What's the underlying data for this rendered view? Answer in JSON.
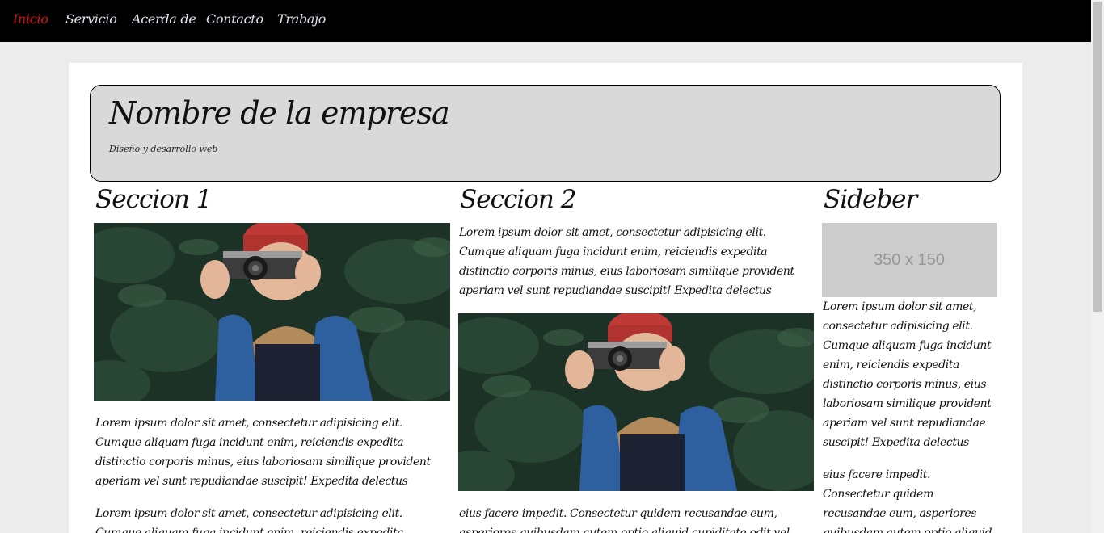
{
  "nav": {
    "items": [
      {
        "label": "Inicio"
      },
      {
        "label": "Servicio"
      },
      {
        "label": "Acerda de"
      },
      {
        "label": "Contacto"
      },
      {
        "label": "Trabajo"
      }
    ]
  },
  "header": {
    "title": "Nombre de la empresa",
    "tagline": "Diseño y desarrollo web"
  },
  "section1": {
    "title": "Seccion 1",
    "para1": "Lorem ipsum dolor sit amet, consectetur adipisicing elit. Cumque aliquam fuga incidunt enim, reiciendis expedita distinctio corporis minus, eius laboriosam similique provident aperiam vel sunt repudiandae suscipit! Expedita delectus quibusdam,",
    "para2": "Lorem ipsum dolor sit amet, consectetur adipisicing elit. Cumque aliquam fuga incidunt enim, reiciendis expedita distinctio corporis"
  },
  "section2": {
    "title": "Seccion 2",
    "para1": "Lorem ipsum dolor sit amet, consectetur adipisicing elit. Cumque aliquam fuga incidunt enim, reiciendis expedita distinctio corporis minus, eius laboriosam similique provident aperiam vel sunt repudiandae suscipit! Expedita delectus quibusdam,",
    "para2": "eius facere impedit. Consectetur quidem recusandae eum, asperiores quibusdam autem optio aliquid cupiditate odit vel dolor illo in mollitia"
  },
  "sidebar": {
    "title": "Sideber",
    "placeholder_text": "350 x 150",
    "para1": "Lorem ipsum dolor sit amet, consectetur adipisicing elit. Cumque aliquam fuga incidunt enim, reiciendis expedita distinctio corporis minus, eius laboriosam similique provident aperiam vel sunt repudiandae suscipit! Expedita delectus quibusdam,",
    "para2": "eius facere impedit. Consectetur quidem recusandae eum, asperiores quibusdam autem optio aliquid cupiditate odit vel dolor"
  },
  "colors": {
    "nav_bg": "#000000",
    "nav_active": "#e01010",
    "header_bg": "#d9d9d9",
    "page_bg": "#ececec"
  }
}
